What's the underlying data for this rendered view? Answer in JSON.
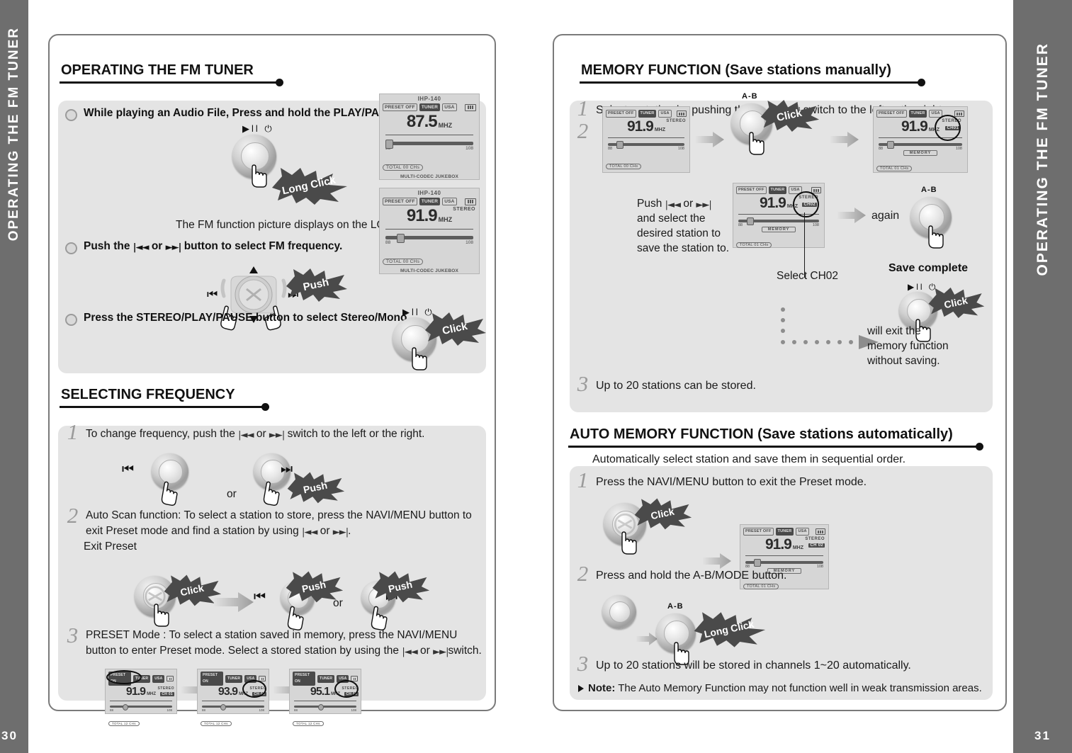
{
  "spread": {
    "left_tab_text": "OPERATING THE FM TUNER",
    "right_tab_text": "OPERATING THE FM TUNER",
    "left_page_number": "30",
    "right_page_number": "31"
  },
  "left_page": {
    "section1": {
      "title": "OPERATING THE FM TUNER",
      "bullets": [
        {
          "text": "While playing an Audio File, Press and hold the PLAY/PAUSE button."
        },
        {
          "text_a": "Push the ",
          "glyph_a": "|◄◄",
          "text_b": " or ",
          "glyph_b": "►►|",
          "text_c": " button to select FM frequency."
        },
        {
          "text": "Press the STEREO/PLAY/PAUSE button to select Stereo/Mono."
        }
      ],
      "lcd_caption": "The FM function picture displays on the LCD.",
      "callout_long_click": "Long Click",
      "callout_push": "Push",
      "callout_click": "Click",
      "button_label_playpause": "▶ll ⏻",
      "lcd1": {
        "model": "IHP-140",
        "preset": "PRESET OFF",
        "tuner": "TUNER",
        "region": "USA",
        "freq": "87.5",
        "unit": "MHZ",
        "stereo": "",
        "scale_min": "88",
        "scale_max": "108",
        "total": "TOTAL    00 CHs",
        "footer": "MULTI-CODEC JUKEBOX"
      },
      "lcd2": {
        "model": "IHP-140",
        "preset": "PRESET OFF",
        "tuner": "TUNER",
        "region": "USA",
        "freq": "91.9",
        "unit": "MHZ",
        "stereo": "STEREO",
        "scale_min": "88",
        "scale_max": "108",
        "total": "TOTAL    00 CHs",
        "footer": "MULTI-CODEC JUKEBOX"
      }
    },
    "section2": {
      "title": "SELECTING FREQUENCY",
      "steps": [
        {
          "num": "1",
          "text_a": "To change frequency, push the ",
          "glyph_a": "|◄◄",
          "text_b": " or ",
          "glyph_b": "►►|",
          "text_c": " switch to the left or the right."
        },
        {
          "num": "2",
          "text_a": "Auto Scan function: To select a station to store, press the NAVI/MENU button to exit Preset mode and find a station by using ",
          "glyph_a": "|◄◄",
          "text_b": " or ",
          "glyph_b": "►►|",
          "text_c": "."
        },
        {
          "num": "3",
          "text_a": "PRESET Mode : To select a station saved in memory, press the NAVI/MENU button to enter Preset mode.  Select a stored station by using the ",
          "glyph_a": "|◄◄",
          "text_b": " or ",
          "glyph_b": "►►|",
          "text_c": "switch."
        }
      ],
      "exit_preset_label": "Exit Preset",
      "or_label": "or",
      "callout_push": "Push",
      "callout_click": "Click",
      "preset_lcds": [
        {
          "preset": "PRESET ON",
          "tuner": "TUNER",
          "region": "USA",
          "freq": "91.9",
          "unit": "MHZ",
          "stereo": "STEREO",
          "ch": "CH 01",
          "scale_min": "88",
          "scale_max": "108",
          "total": "TOTAL    12 CHs",
          "highlight": "preset"
        },
        {
          "preset": "PRESET ON",
          "tuner": "TUNER",
          "region": "USA",
          "freq": "93.9",
          "unit": "MHZ",
          "stereo": "STEREO",
          "ch": "CH 03",
          "scale_min": "88",
          "scale_max": "108",
          "total": "TOTAL    12 CHs",
          "highlight": "ch"
        },
        {
          "preset": "PRESET ON",
          "tuner": "TUNER",
          "region": "USA",
          "freq": "95.1",
          "unit": "MHZ",
          "stereo": "STEREO",
          "ch": "CH 06",
          "scale_min": "88",
          "scale_max": "108",
          "total": "TOTAL    12 CHs",
          "highlight": "ch"
        }
      ]
    }
  },
  "right_page": {
    "section1": {
      "title": "MEMORY FUNCTION (Save stations manually)",
      "steps": [
        {
          "num": "1",
          "text_a": "Select a station by pushing the ",
          "glyph_a": "|◄◄",
          "text_b": " or ",
          "glyph_b": "►►|",
          "text_c": " switch to the left or the right."
        },
        {
          "num": "2",
          "text": ""
        },
        {
          "num": "3",
          "text": "Up to 20 stations can be stored."
        }
      ],
      "push_block": "Push |◄◄ or ►►|\nand select the\ndesired station to\nsave the station to.",
      "push_block_lines": [
        "and select the",
        "desired station to",
        "save the station to."
      ],
      "push_prefix": "Push ",
      "push_or": " or ",
      "again_label": "again",
      "save_complete_label": "Save complete",
      "select_ch_label": "Select CH02",
      "exit_note_lines": [
        "will exit the",
        "memory function",
        "without saving."
      ],
      "ab_label": "A-B",
      "callout_click": "Click",
      "button_label_playpause": "▶ll ⏻",
      "lcd_before": {
        "preset": "PRESET OFF",
        "tuner": "TUNER",
        "region": "USA",
        "freq": "91.9",
        "unit": "MHZ",
        "stereo": "STEREO",
        "scale_min": "88",
        "scale_max": "108",
        "total": "TOTAL    00 CHs"
      },
      "lcd_after": {
        "preset": "PRESET OFF",
        "tuner": "TUNER",
        "region": "USA",
        "freq": "91.9",
        "unit": "MHZ",
        "stereo": "STEREO",
        "ch": "CH01",
        "memory": "MEMORY",
        "scale_min": "88",
        "scale_max": "108",
        "total": "TOTAL    01 CHs"
      },
      "lcd_ch02": {
        "preset": "PRESET OFF",
        "tuner": "TUNER",
        "region": "USA",
        "freq": "91.9",
        "unit": "MHZ",
        "stereo": "STEREO",
        "ch": "CH02",
        "memory": "MEMORY",
        "scale_min": "88",
        "scale_max": "108",
        "total": "TOTAL    01 CHs"
      }
    },
    "section2": {
      "title": "AUTO MEMORY FUNCTION (Save stations automatically)",
      "intro": "Automatically select station and save them in sequential order.",
      "steps": [
        {
          "num": "1",
          "text": "Press the NAVI/MENU button to exit the Preset mode."
        },
        {
          "num": "2",
          "text": "Press and hold the A-B/MODE button."
        },
        {
          "num": "3",
          "text": "Up to 20 stations will be stored in channels 1~20 automatically."
        }
      ],
      "note_label": "Note:",
      "note_text": " The Auto Memory Function may not function well in weak transmission areas.",
      "callout_click": "Click",
      "callout_long_click": "Long Click",
      "ab_label": "A-B",
      "lcd": {
        "preset": "PRESET OFF",
        "tuner": "TUNER",
        "region": "USA",
        "freq": "91.9",
        "unit": "MHZ",
        "stereo": "STEREO",
        "ch": "CH 02",
        "memory": "MEMORY",
        "scale_min": "88",
        "scale_max": "108",
        "total": "TOTAL    01 CHs"
      }
    }
  },
  "colors": {
    "tab_gray": "#6e6e6e",
    "box_gray": "#e4e4e4",
    "burst_gray": "#4a4a4a",
    "text_dark": "#1a1a1a"
  }
}
